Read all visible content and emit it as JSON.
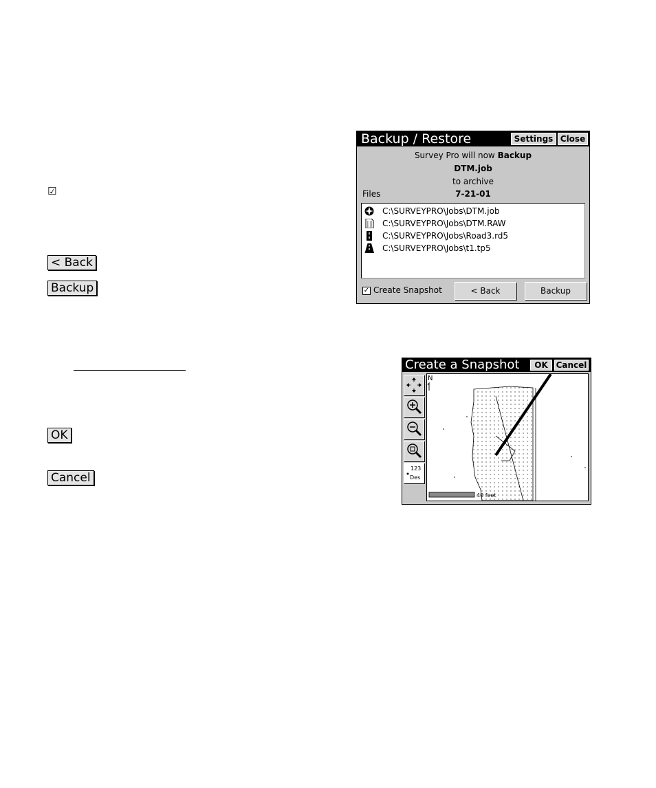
{
  "left_margin": {
    "checkbox_glyph": "☑",
    "back_label": "< Back",
    "backup_label": "Backup",
    "ok_label": "OK",
    "cancel_label": "Cancel"
  },
  "backup_window": {
    "title": "Backup / Restore",
    "settings_label": "Settings",
    "close_label": "Close",
    "message_line1_prefix": "Survey Pro will now",
    "message_line1_action": "Backup",
    "job_name": "DTM.job",
    "message_line3": "to archive",
    "files_label": "Files",
    "archive_name": "7-21-01",
    "files": [
      {
        "icon": "job-icon",
        "path": "C:\\SURVEYPRO\\Jobs\\DTM.job"
      },
      {
        "icon": "raw-file-icon",
        "path": "C:\\SURVEYPRO\\Jobs\\DTM.RAW"
      },
      {
        "icon": "road-icon",
        "path": "C:\\SURVEYPRO\\Jobs\\Road3.rd5"
      },
      {
        "icon": "template-icon",
        "path": "C:\\SURVEYPRO\\Jobs\\t1.tp5"
      }
    ],
    "snapshot_checkbox_label": "Create Snapshot",
    "snapshot_checked": true,
    "back_button": "< Back",
    "backup_button": "Backup"
  },
  "snapshot_window": {
    "title": "Create a Snapshot",
    "ok_label": "OK",
    "cancel_label": "Cancel",
    "north_label": "N",
    "scale_label": "40 feet",
    "des_tool_top": "123",
    "des_tool_bottom": "Des",
    "tools": [
      "pan-icon",
      "zoom-in-icon",
      "zoom-out-icon",
      "zoom-extents-icon",
      "description-icon"
    ]
  }
}
